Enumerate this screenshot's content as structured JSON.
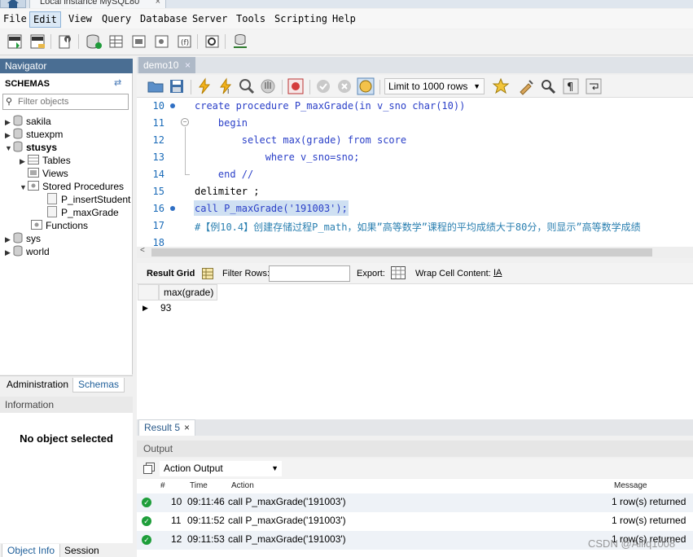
{
  "window": {
    "connection_tab": "Local instance MySQL80",
    "close_glyph": "×"
  },
  "menu": [
    "File",
    "Edit",
    "View",
    "Query",
    "Database",
    "Server",
    "Tools",
    "Scripting",
    "Help"
  ],
  "navigator": {
    "title": "Navigator",
    "schemas_label": "SCHEMAS",
    "filter_placeholder": "Filter objects",
    "schemas": [
      {
        "name": "sakila",
        "expanded": false
      },
      {
        "name": "stuexpm",
        "expanded": false
      },
      {
        "name": "stusys",
        "expanded": true
      },
      {
        "name": "sys",
        "expanded": false
      },
      {
        "name": "world",
        "expanded": false
      }
    ],
    "stusys_children": [
      "Tables",
      "Views",
      "Stored Procedures",
      "Functions"
    ],
    "procedures": [
      "P_insertStudent",
      "P_maxGrade"
    ]
  },
  "left_tabs": {
    "administration": "Administration",
    "schemas": "Schemas",
    "information": "Information",
    "no_object": "No object selected",
    "object_info": "Object Info",
    "session": "Session"
  },
  "editor": {
    "tab": "demo10",
    "limit": "Limit to 1000 rows",
    "line_numbers": [
      "10",
      "11",
      "12",
      "13",
      "14",
      "15",
      "16",
      "17",
      "18"
    ],
    "lines": {
      "l10": "create procedure P_maxGrade(in v_sno char(10))",
      "l11": "    begin",
      "l12": "        select max(grade) from score",
      "l13": "            where v_sno=sno;",
      "l14": "    end //",
      "l15": "delimiter ;",
      "l16": "call P_maxGrade('191003');",
      "l17": "#【例10.4】创建存储过程P_math，如果”高等数学”课程的平均成绩大于80分，则显示”高等数学成绩"
    },
    "scroll_left_glyph": "<"
  },
  "result_grid": {
    "tab": "Result Grid",
    "filter_label": "Filter Rows:",
    "export_label": "Export:",
    "wrap_label": "Wrap Cell Content:",
    "column": "max(grade)",
    "value": "93"
  },
  "result_tab": "Result 5",
  "output": {
    "title": "Output",
    "mode": "Action Output",
    "headers": {
      "num": "#",
      "time": "Time",
      "action": "Action",
      "message": "Message"
    },
    "rows": [
      {
        "num": "10",
        "time": "09:11:46",
        "action": "call P_maxGrade('191003')",
        "message": "1 row(s) returned"
      },
      {
        "num": "11",
        "time": "09:11:52",
        "action": "call P_maxGrade('191003')",
        "message": "1 row(s) returned"
      },
      {
        "num": "12",
        "time": "09:11:53",
        "action": "call P_maxGrade('191003')",
        "message": "1 row(s) returned"
      }
    ]
  },
  "watermark": "CSDN @Alllq1008",
  "colors": {
    "navigator_header": "#4a6e93",
    "keyword": "#2a3fc8",
    "string": "#1a8a1a",
    "comment": "#2a7fb0",
    "selection": "#cfe0f2",
    "ok_green": "#1e9e3a"
  }
}
